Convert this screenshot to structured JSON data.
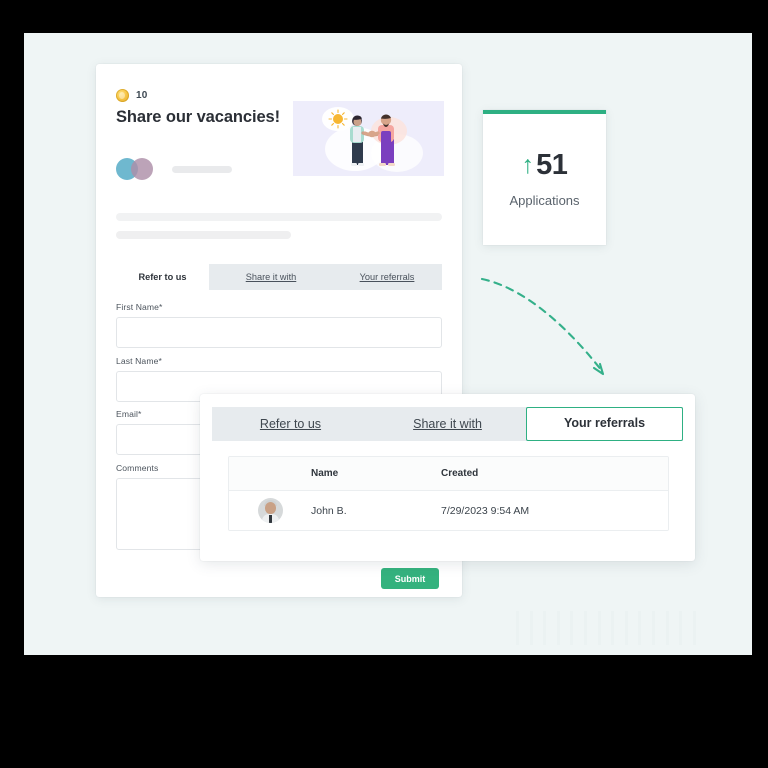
{
  "form_card": {
    "coin_icon": "coin-icon",
    "coin_count": "10",
    "title": "Share our vacancies!",
    "illustration_alt": "two-people-handshake-illustration",
    "tabs": [
      {
        "label": "Refer to us",
        "active": true
      },
      {
        "label": "Share it with",
        "active": false
      },
      {
        "label": "Your referrals",
        "active": false
      }
    ],
    "fields": [
      {
        "label": "First Name*",
        "value": "",
        "placeholder": ""
      },
      {
        "label": "Last Name*",
        "value": "",
        "placeholder": ""
      },
      {
        "label": "Email*",
        "value": "",
        "placeholder": ""
      },
      {
        "label": "Comments",
        "value": "",
        "placeholder": ""
      }
    ],
    "submit_label": "Submit"
  },
  "stat_card": {
    "arrow": "↑",
    "value": "51",
    "label": "Applications",
    "accent_color": "#2eb083"
  },
  "referrals_panel": {
    "tabs": [
      {
        "label": "Refer to us",
        "active": false
      },
      {
        "label": "Share it with",
        "active": false
      },
      {
        "label": "Your referrals",
        "active": true
      }
    ],
    "table": {
      "columns": [
        "",
        "Name",
        "Created"
      ],
      "headers": {
        "name": "Name",
        "created": "Created"
      },
      "rows": [
        {
          "avatar": "user-photo-avatar",
          "name": "John B.",
          "created": "7/29/2023 9:54 AM"
        }
      ]
    }
  },
  "decor": {
    "arrow": "dashed-curved-arrow",
    "arrow_color": "#2eb083"
  },
  "colors": {
    "page_background": "#eff5f5",
    "outer_background": "#000000",
    "card_background": "#ffffff",
    "accent_green": "#2eb083",
    "submit_green": "#34b27e",
    "tab_strip_gray": "#e7ebee",
    "text_dark": "#2c3138",
    "coin_gold": "#f6c445"
  }
}
